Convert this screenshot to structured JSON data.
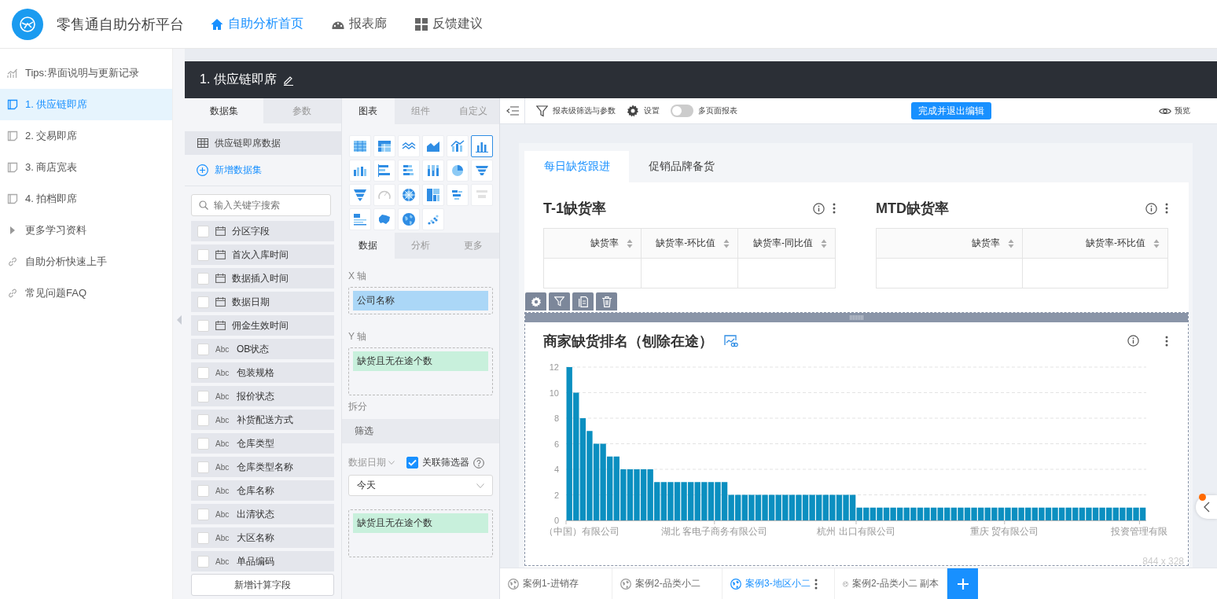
{
  "header": {
    "title": "零售通自助分析平台",
    "nav": [
      {
        "label": "自助分析首页",
        "kind": "home",
        "selected": true
      },
      {
        "label": "报表廊",
        "kind": "gallery",
        "selected": false
      },
      {
        "label": "反馈建议",
        "kind": "feedback",
        "selected": false
      }
    ]
  },
  "sidebar": {
    "items": [
      {
        "label": "Tips:界面说明与更新记录",
        "kind": "tips",
        "selected": false
      },
      {
        "label": "1. 供应链即席",
        "kind": "report",
        "selected": true
      },
      {
        "label": "2. 交易即席",
        "kind": "report",
        "selected": false
      },
      {
        "label": "3. 商店宽表",
        "kind": "report",
        "selected": false
      },
      {
        "label": "4. 拍档即席",
        "kind": "report",
        "selected": false
      },
      {
        "label": "更多学习资料",
        "kind": "folder",
        "selected": false
      },
      {
        "label": "自助分析快速上手",
        "kind": "link",
        "selected": false
      },
      {
        "label": "常见问题FAQ",
        "kind": "link",
        "selected": false
      }
    ]
  },
  "report": {
    "title": "1. 供应链即席"
  },
  "data_panel": {
    "tabs": [
      {
        "label": "数据集",
        "selected": true
      },
      {
        "label": "参数",
        "selected": false
      }
    ],
    "dataset": "供应链即席数据",
    "add_dataset": "新增数据集",
    "search": {
      "placeholder": "输入关键字搜索"
    },
    "fields": [
      {
        "kind": "date",
        "name": "分区字段",
        "checked": false
      },
      {
        "kind": "date",
        "name": "首次入库时间",
        "checked": false
      },
      {
        "kind": "date",
        "name": "数据插入时间",
        "checked": false
      },
      {
        "kind": "date",
        "name": "数据日期",
        "checked": false
      },
      {
        "kind": "date",
        "name": "佣金生效时间",
        "checked": false
      },
      {
        "kind": "text",
        "type_label": "Abc",
        "name": "OB状态",
        "checked": false
      },
      {
        "kind": "text",
        "type_label": "Abc",
        "name": "包装规格",
        "checked": false
      },
      {
        "kind": "text",
        "type_label": "Abc",
        "name": "报价状态",
        "checked": false
      },
      {
        "kind": "text",
        "type_label": "Abc",
        "name": "补货配送方式",
        "checked": false
      },
      {
        "kind": "text",
        "type_label": "Abc",
        "name": "仓库类型",
        "checked": false
      },
      {
        "kind": "text",
        "type_label": "Abc",
        "name": "仓库类型名称",
        "checked": false
      },
      {
        "kind": "text",
        "type_label": "Abc",
        "name": "仓库名称",
        "checked": false
      },
      {
        "kind": "text",
        "type_label": "Abc",
        "name": "出清状态",
        "checked": false
      },
      {
        "kind": "text",
        "type_label": "Abc",
        "name": "大区名称",
        "checked": false
      },
      {
        "kind": "text",
        "type_label": "Abc",
        "name": "单品编码",
        "checked": false
      }
    ],
    "add_field_button": "新增计算字段"
  },
  "config_panel": {
    "tabs": [
      {
        "label": "图表",
        "selected": true
      },
      {
        "label": "组件",
        "selected": false
      },
      {
        "label": "自定义",
        "selected": false
      }
    ],
    "chart_types": [
      {
        "kind": "table",
        "selected": false,
        "disabled": false
      },
      {
        "kind": "crosstab",
        "selected": false,
        "disabled": false
      },
      {
        "kind": "line",
        "selected": false,
        "disabled": false
      },
      {
        "kind": "area",
        "selected": false,
        "disabled": false
      },
      {
        "kind": "combo",
        "selected": false,
        "disabled": false
      },
      {
        "kind": "column",
        "selected": true,
        "disabled": false
      },
      {
        "kind": "grouped",
        "selected": false,
        "disabled": false
      },
      {
        "kind": "bar",
        "selected": false,
        "disabled": false
      },
      {
        "kind": "stacked_bar",
        "selected": false,
        "disabled": false
      },
      {
        "kind": "stacked_column",
        "selected": false,
        "disabled": false
      },
      {
        "kind": "pie",
        "selected": false,
        "disabled": false
      },
      {
        "kind": "funnel",
        "selected": false,
        "disabled": false
      },
      {
        "kind": "funnel2",
        "selected": false,
        "disabled": false
      },
      {
        "kind": "gauge",
        "selected": false,
        "disabled": true
      },
      {
        "kind": "radar",
        "selected": false,
        "disabled": false
      },
      {
        "kind": "treemap",
        "selected": false,
        "disabled": false
      },
      {
        "kind": "wordcloud",
        "selected": false,
        "disabled": false
      },
      {
        "kind": "kpi",
        "selected": false,
        "disabled": true
      },
      {
        "kind": "text_card",
        "selected": false,
        "disabled": false
      },
      {
        "kind": "china_map",
        "selected": false,
        "disabled": false
      },
      {
        "kind": "globe",
        "selected": false,
        "disabled": false
      },
      {
        "kind": "scatter",
        "selected": false,
        "disabled": false
      }
    ],
    "sub_tabs": [
      {
        "label": "数据",
        "selected": true
      },
      {
        "label": "分析",
        "selected": false
      },
      {
        "label": "更多",
        "selected": false
      }
    ],
    "x_axis": {
      "label": "X 轴",
      "fields": [
        {
          "name": "公司名称",
          "kind": "dimension"
        }
      ]
    },
    "y_axis": {
      "label": "Y 轴",
      "fields": [
        {
          "name": "缺货且无在途个数",
          "kind": "measure"
        }
      ]
    },
    "split_label": "拆分",
    "filter": {
      "title": "筛选",
      "field_label": "数据日期",
      "link_filter": {
        "label": "关联筛选器",
        "checked": true
      },
      "select": {
        "value": "今天"
      },
      "fields": [
        {
          "name": "缺货且无在途个数",
          "kind": "measure"
        }
      ]
    }
  },
  "toolbar": {
    "items": [
      {
        "label": "报表级筛选与参数",
        "kind": "filter"
      },
      {
        "label": "设置",
        "kind": "settings"
      },
      {
        "label": "多页面报表",
        "kind": "toggle",
        "on": false
      }
    ],
    "primary_button": "完成并退出编辑",
    "preview": "预览"
  },
  "page_tabs": [
    {
      "label": "每日缺货跟进",
      "selected": true
    },
    {
      "label": "促销品牌备货",
      "selected": false
    }
  ],
  "tables": [
    {
      "title": "T-1缺货率",
      "columns": [
        "缺货率",
        "缺货率-环比值",
        "缺货率-同比值"
      ]
    },
    {
      "title": "MTD缺货率",
      "columns": [
        "缺货率",
        "缺货率-环比值"
      ]
    }
  ],
  "chart_widget": {
    "title": "商家缺货排名（刨除在途）",
    "size": "844 x 328",
    "x_axis_labels": [
      "（中国）有限公司",
      "湖北 客电子商务有限公司",
      "杭州 出口有限公司",
      "重庆 贸有限公司",
      "投资管理有限"
    ],
    "chart_data": {
      "type": "bar",
      "ylim": [
        0,
        12
      ],
      "yticks": [
        0,
        2,
        4,
        6,
        8,
        10,
        12
      ],
      "grid": true,
      "series": [
        {
          "color": "#0b8fc0",
          "values": [
            12,
            10,
            8,
            7,
            6,
            6,
            5,
            5,
            4,
            4,
            4,
            4,
            4,
            3,
            3,
            3,
            3,
            3,
            3,
            3,
            3,
            3,
            3,
            3,
            2,
            2,
            2,
            2,
            2,
            2,
            2,
            2,
            2,
            2,
            2,
            2,
            2,
            2,
            2,
            2,
            2,
            2,
            2,
            1,
            1,
            1,
            1,
            1,
            1,
            1,
            1,
            1,
            1,
            1,
            1,
            1,
            1,
            1,
            1,
            1,
            1,
            1,
            1,
            1,
            1,
            1,
            1,
            1,
            1,
            1,
            1,
            1,
            1,
            1,
            1,
            1,
            1,
            1,
            1,
            1,
            1,
            1,
            1,
            1,
            1,
            1
          ]
        }
      ]
    }
  },
  "bottom_tabs": [
    {
      "label": "案例1-进销存",
      "selected": false
    },
    {
      "label": "案例2-品类小二",
      "selected": false
    },
    {
      "label": "案例3-地区小二",
      "selected": true
    },
    {
      "label": "案例2-品类小二 副本",
      "selected": false
    }
  ]
}
